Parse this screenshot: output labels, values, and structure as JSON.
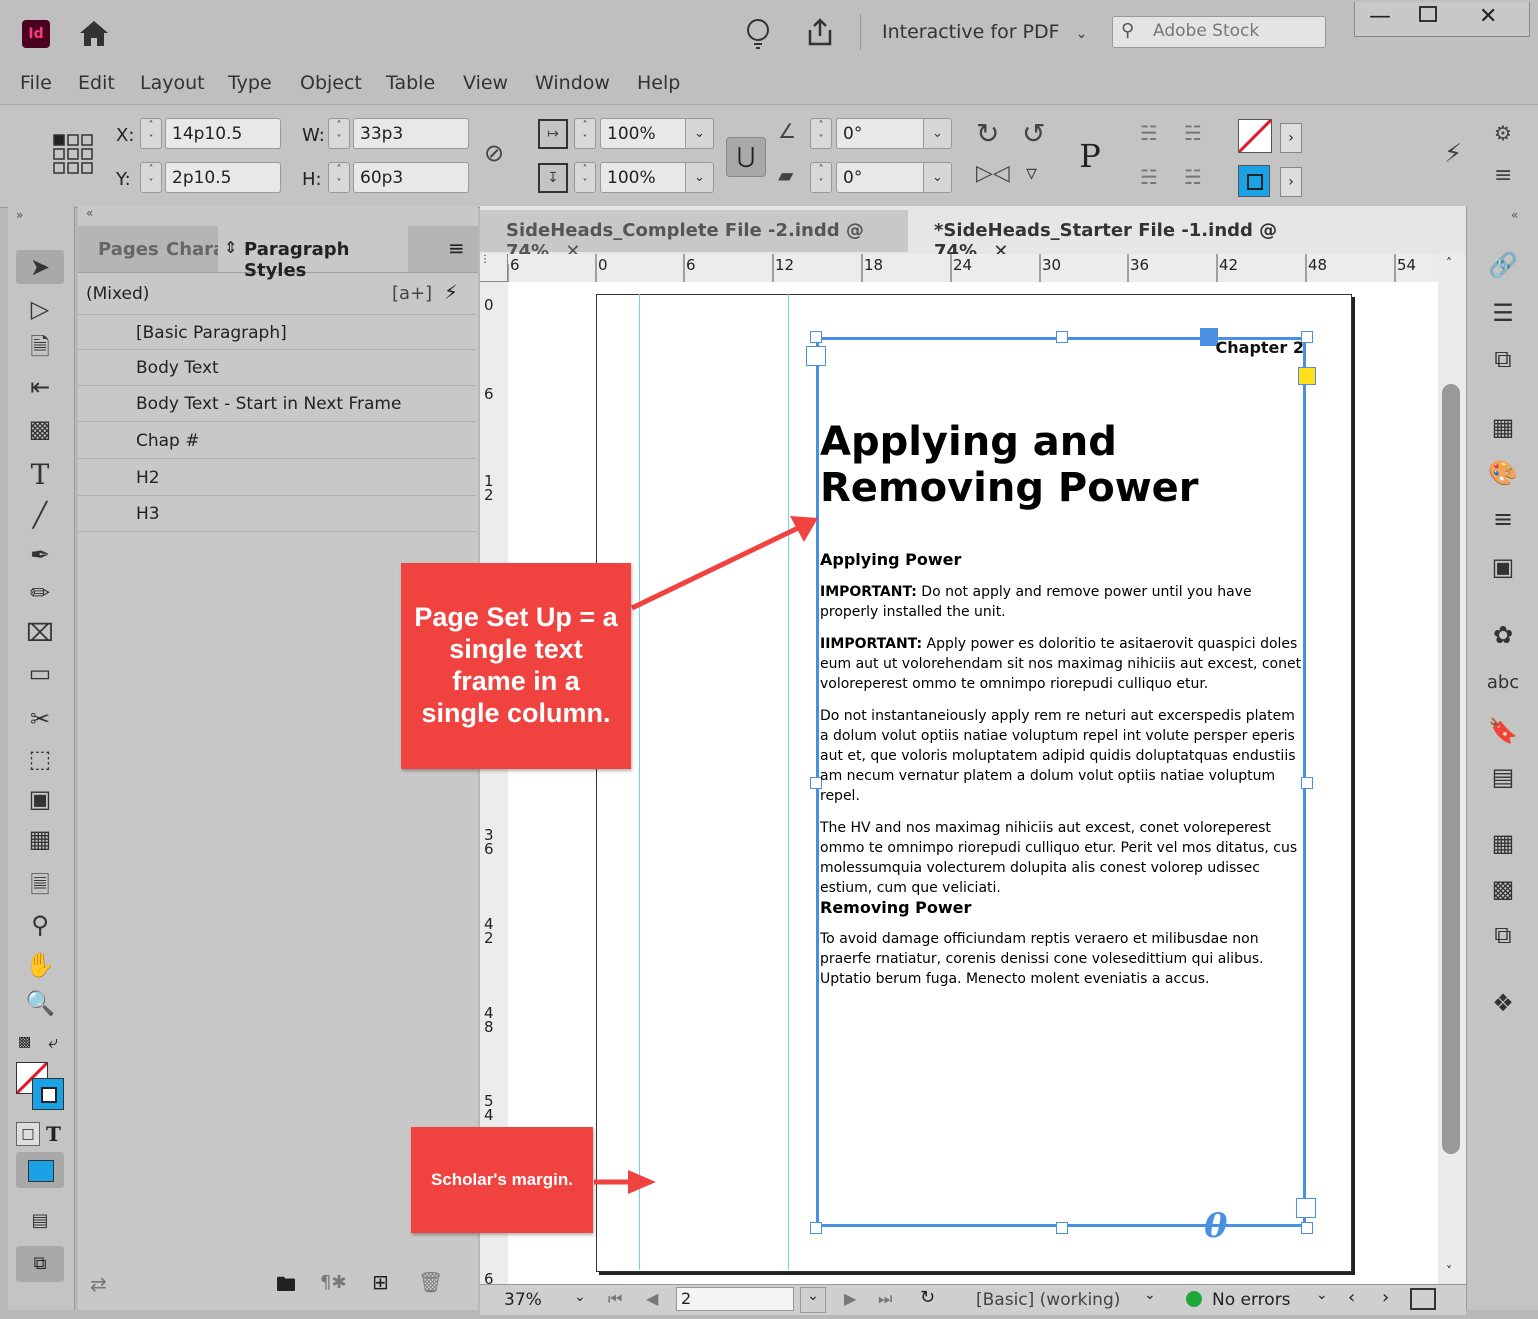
{
  "app": {
    "logo_text": "Id",
    "workspace": "Interactive for PDF",
    "search_placeholder": "Adobe Stock"
  },
  "menu": [
    "File",
    "Edit",
    "Layout",
    "Type",
    "Object",
    "Table",
    "View",
    "Window",
    "Help"
  ],
  "control": {
    "x_label": "X:",
    "x_value": "14p10.5",
    "y_label": "Y:",
    "y_value": "2p10.5",
    "w_label": "W:",
    "w_value": "33p3",
    "h_label": "H:",
    "h_value": "60p3",
    "scale_x": "100%",
    "scale_y": "100%",
    "rotate": "0°",
    "shear": "0°"
  },
  "panel": {
    "tabs": [
      "Pages",
      "Chara",
      "Paragraph Styles"
    ],
    "current": "(Mixed)",
    "new_style_btn": "[a+]",
    "styles": [
      "[Basic Paragraph]",
      "Body Text",
      "Body Text - Start in Next Frame",
      "Chap #",
      "H2",
      "H3"
    ]
  },
  "doc_tabs": [
    "SideHeads_Complete File -2.indd @ 74%",
    "*SideHeads_Starter File -1.indd @ 74%"
  ],
  "ruler_h": [
    "6",
    "0",
    "6",
    "12",
    "18",
    "24",
    "30",
    "36",
    "42",
    "48",
    "54"
  ],
  "ruler_v": [
    "0",
    "6",
    "1\n2",
    "3\n6",
    "4\n2",
    "4\n8",
    "5\n4",
    "6"
  ],
  "page": {
    "chapter": "Chapter 2",
    "title_line1": "Applying and",
    "title_line2": "Removing Power",
    "h2_applying": "Applying Power",
    "p1_bold": "IMPORTANT:",
    "p1_text": " Do not apply and remove power until you have properly installed the unit.",
    "p2_bold": "IIMPORTANT:",
    "p2_text": " Apply power es doloritio te asitaerovit quaspici doles eum aut ut volorehendam sit nos maximag nihiciis aut excest, conet voloreperest ommo te omnimpo riorepudi culliquo etur.",
    "p3": "Do not  instantaneiously apply rem re neturi aut excerspedis platem a dolum volut optiis natiae voluptum repel int volute persper eperis aut et, que voloris moluptatem adipid quidis doluptatquas endustiis am necum vernatur platem a dolum volut optiis natiae voluptum repel.",
    "p4": "The HV and nos maximag nihiciis aut excest, conet voloreperest ommo te omnimpo riorepudi culliquo etur. Perit vel mos ditatus, cus molessumquia volecturem dolupita alis conest volorep udissec estium, cum que veliciati.",
    "h2_removing": "Removing Power",
    "p5": "To avoid damage officiundam reptis veraero et milibusdae non praerfe rnatiatur, corenis denissi cone volesedittium qui alibus. Uptatio berum fuga. Menecto molent eveniatis a accus.",
    "overset": "0"
  },
  "callouts": {
    "setup": "Page Set Up = a  single text frame in a single column.",
    "margin": "Scholar's margin."
  },
  "status": {
    "zoom": "37%",
    "page": "2",
    "preflight_profile": "[Basic] (working)",
    "errors": "No errors"
  },
  "colors": {
    "accent_blue": "#4a90e2",
    "callout_red": "#f0423f",
    "guide_cyan": "#6dd3f0",
    "ok_green": "#1fa83a"
  }
}
